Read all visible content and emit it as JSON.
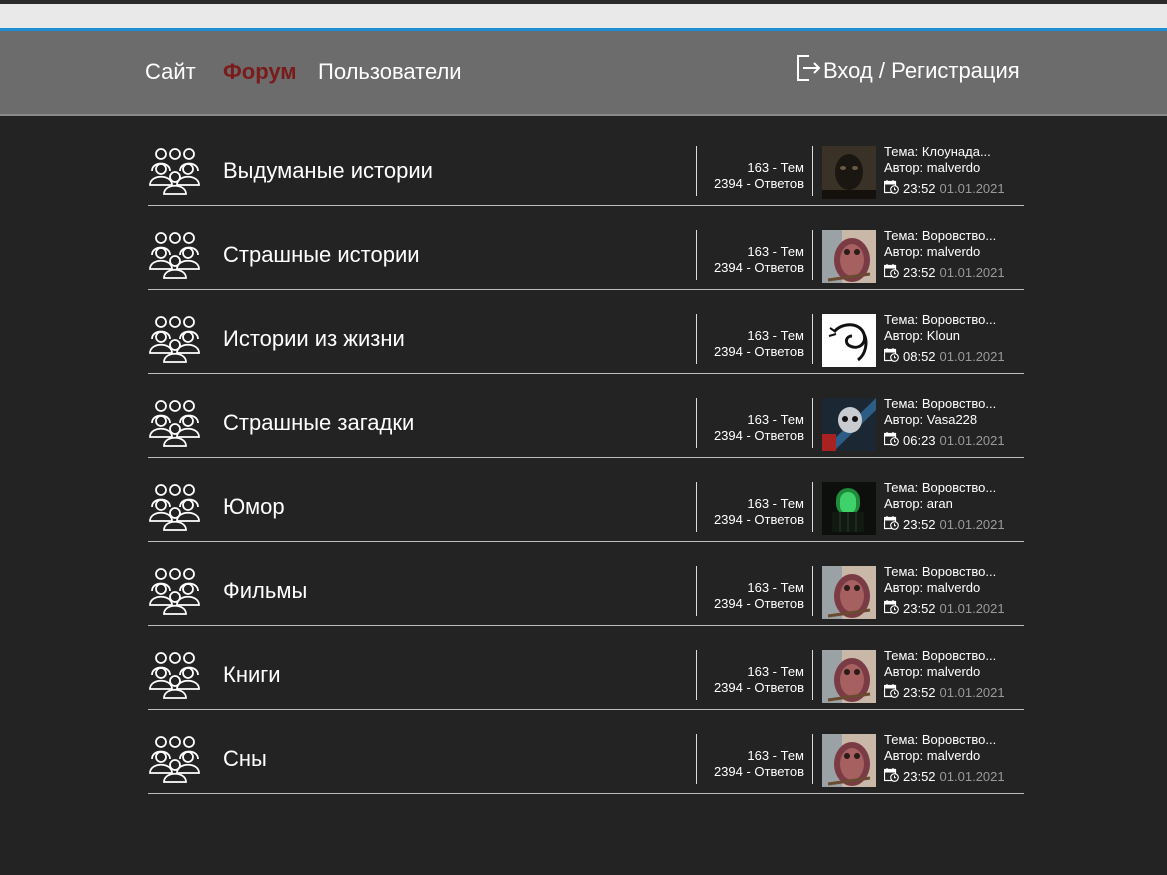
{
  "nav": {
    "site": "Сайт",
    "forum": "Форум",
    "users": "Пользователи",
    "login": "Вход / Регистрация",
    "login_icon": "sign-in-icon",
    "active_color": "#7a1a1a"
  },
  "forum": {
    "rows": [
      {
        "title": "Выдуманые истории",
        "topics": "163 - Тем",
        "replies": "2394 - Ответов",
        "topic": "Тема: Клоунада...",
        "author": "Автор: malverdo",
        "time": "23:52",
        "date": "01.01.2021",
        "thumb": "dark-face"
      },
      {
        "title": "Страшные истории",
        "topics": "163 - Тем",
        "replies": "2394 - Ответов",
        "topic": "Тема: Воровство...",
        "author": "Автор: malverdo",
        "time": "23:52",
        "date": "01.01.2021",
        "thumb": "owl"
      },
      {
        "title": "Истории из жизни",
        "topics": "163 - Тем",
        "replies": "2394 - Ответов",
        "topic": "Тема: Воровство...",
        "author": "Автор: Kloun",
        "time": "08:52",
        "date": "01.01.2021",
        "thumb": "dragon-logo"
      },
      {
        "title": "Страшные загадки",
        "topics": "163 - Тем",
        "replies": "2394 - Ответов",
        "topic": "Тема: Воровство...",
        "author": "Автор: Vasa228",
        "time": "06:23",
        "date": "01.01.2021",
        "thumb": "skull-art"
      },
      {
        "title": "Юмор",
        "topics": "163 - Тем",
        "replies": "2394 - Ответов",
        "topic": "Тема: Воровство...",
        "author": "Автор: aran",
        "time": "23:52",
        "date": "01.01.2021",
        "thumb": "green-window"
      },
      {
        "title": "Фильмы",
        "topics": "163 - Тем",
        "replies": "2394 - Ответов",
        "topic": "Тема: Воровство...",
        "author": "Автор: malverdo",
        "time": "23:52",
        "date": "01.01.2021",
        "thumb": "owl"
      },
      {
        "title": "Книги",
        "topics": "163 - Тем",
        "replies": "2394 - Ответов",
        "topic": "Тема: Воровство...",
        "author": "Автор: malverdo",
        "time": "23:52",
        "date": "01.01.2021",
        "thumb": "owl"
      },
      {
        "title": "Сны",
        "topics": "163 - Тем",
        "replies": "2394 - Ответов",
        "topic": "Тема: Воровство...",
        "author": "Автор: malverdo",
        "time": "23:52",
        "date": "01.01.2021",
        "thumb": "owl"
      }
    ]
  }
}
